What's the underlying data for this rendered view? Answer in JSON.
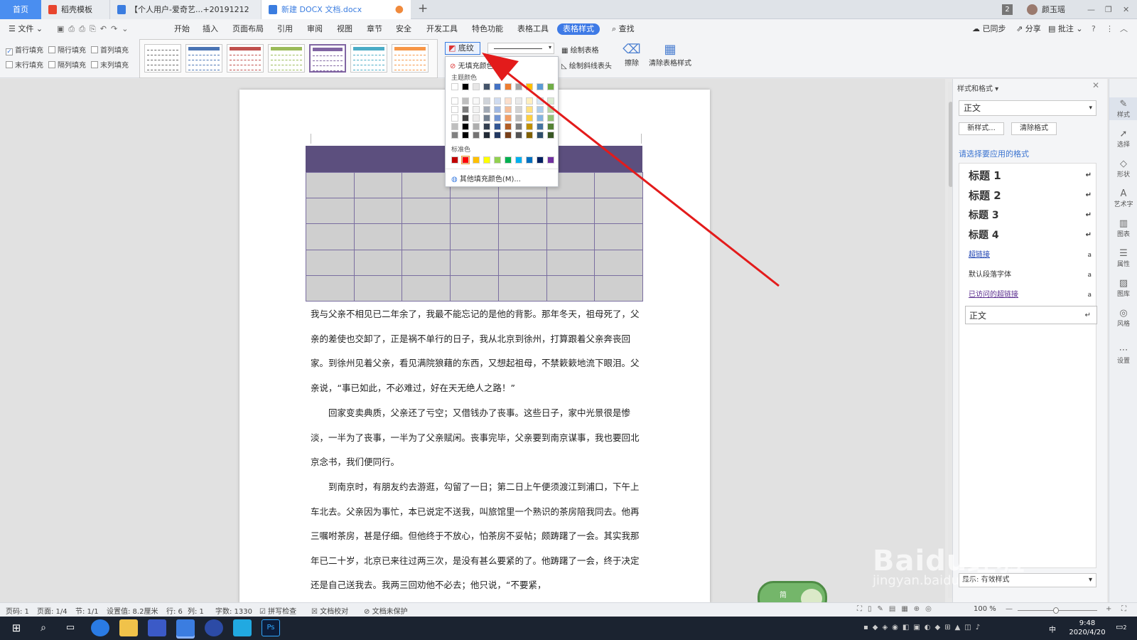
{
  "tabs": {
    "home": "首页",
    "template": "稻壳模板",
    "doc1": "【个人用户-爱奇艺...+20191212",
    "doc2": "新建 DOCX 文档.docx",
    "badge": "2",
    "user": "颜玉瑶"
  },
  "menu": {
    "file": "文件",
    "items": [
      "开始",
      "插入",
      "页面布局",
      "引用",
      "审阅",
      "视图",
      "章节",
      "安全",
      "开发工具",
      "特色功能",
      "表格工具"
    ],
    "active": "表格样式",
    "search": "查找",
    "sync": "已同步",
    "share": "分享",
    "comment": "批注"
  },
  "ribbon": {
    "checks": [
      {
        "label": "首行填充",
        "checked": true
      },
      {
        "label": "隔行填充",
        "checked": false
      },
      {
        "label": "首列填充",
        "checked": false
      },
      {
        "label": "末行填充",
        "checked": false
      },
      {
        "label": "隔列填充",
        "checked": false
      },
      {
        "label": "末列填充",
        "checked": false
      }
    ],
    "shading": "底纹",
    "draw_table": "绘制表格",
    "eraser": "擦除",
    "draw_diag": "绘制斜线表头",
    "clear_style": "清除表格样式",
    "swatch_colors": [
      "#ffffff",
      "#4a74b4",
      "#c0504d",
      "#9bbb59",
      "#8064a2",
      "#4bacc6",
      "#f79646"
    ]
  },
  "dropdown": {
    "no_fill": "无填充颜色",
    "theme": "主题颜色",
    "standard": "标准色",
    "more": "其他填充颜色(M)...",
    "theme_top": [
      "#ffffff",
      "#000000",
      "#e7e6e6",
      "#44546a",
      "#4472c4",
      "#ed7d31",
      "#a5a5a5",
      "#ffc000",
      "#5b9bd5",
      "#70ad47"
    ],
    "standard_colors": [
      "#c00000",
      "#ff0000",
      "#ffc000",
      "#ffff00",
      "#92d050",
      "#00b050",
      "#00b0f0",
      "#0070c0",
      "#002060",
      "#7030a0"
    ]
  },
  "document": {
    "paragraphs": [
      "我与父亲不相见已二年余了，我最不能忘记的是他的背影。那年冬天，祖母死了，父亲的差使也交卸了，正是祸不单行的日子，我从北京到徐州，打算跟着父亲奔丧回家。到徐州见着父亲，看见满院狼藉的东西，又想起祖母，不禁簌簌地流下眼泪。父亲说，“事已如此，不必难过，好在天无绝人之路！”",
      "回家变卖典质，父亲还了亏空；又借钱办了丧事。这些日子，家中光景很是惨淡，一半为了丧事，一半为了父亲赋闲。丧事完毕，父亲要到南京谋事，我也要回北京念书，我们便同行。",
      "到南京时，有朋友约去游逛，勾留了一日；第二日上午便须渡江到浦口，下午上车北去。父亲因为事忙，本已说定不送我，叫旅馆里一个熟识的茶房陪我同去。他再三嘱咐茶房，甚是仔细。但他终于不放心，怕茶房不妥帖；颇踌躇了一会。其实我那年已二十岁，北京已来往过两三次，是没有甚么要紧的了。他踌躇了一会，终于决定还是自己送我去。我两三回劝他不必去；他只说，“不要紧，"
    ]
  },
  "pane": {
    "title": "样式和格式",
    "current": "正文",
    "new_style": "新样式...",
    "clear": "清除格式",
    "prompt": "请选择要应用的格式",
    "styles": [
      "标题 1",
      "标题 2",
      "标题 3",
      "标题 4",
      "超链接",
      "默认段落字体",
      "已访问的超链接",
      "正文"
    ],
    "show_label": "显示",
    "show_value": "有效样式"
  },
  "iconbar": [
    "样式",
    "选择",
    "形状",
    "艺术字",
    "图表",
    "属性",
    "图库",
    "风格",
    "设置"
  ],
  "status": {
    "page": "页码: 1",
    "pages": "页面: 1/4",
    "section": "节: 1/1",
    "setting": "设置值: 8.2厘米",
    "row": "行: 6",
    "col": "列: 1",
    "words": "字数: 1330",
    "spell": "拼写检查",
    "proof": "文档校对",
    "protect": "文档未保护",
    "zoom": "100 %"
  },
  "taskbar": {
    "time": "9:48",
    "date": "2020/4/20",
    "ime": "中",
    "notif": "2"
  },
  "ime_widget": {
    "line1": "简",
    "line2": "中"
  },
  "watermark": "Baidu经验",
  "watermark_url": "jingyan.baidu.com"
}
